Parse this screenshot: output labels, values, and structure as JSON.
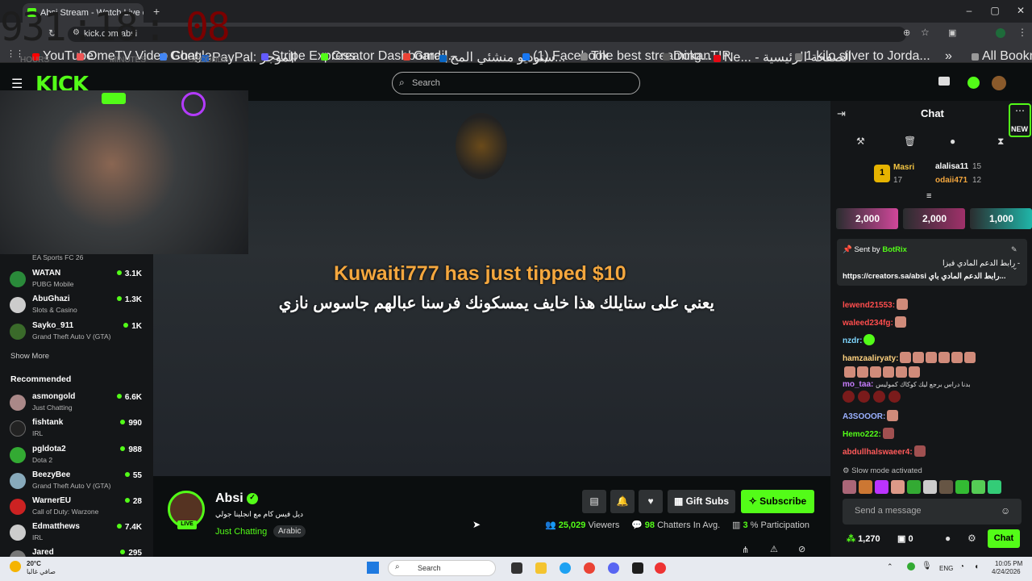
{
  "browser": {
    "tab_title": "Absi Stream - Watch Live o",
    "url": "kick.com/absi",
    "bookmarks": [
      "YouTube",
      "OmeTV Video Chat...",
      "Google",
      "PayPal: الموجز",
      "Stripe Express",
      "Creator Dashboard |...",
      "Gmail",
      "ستوديو منشئي المح...",
      "(1) Facebook",
      "The best streaming...",
      "DokanTIP",
      "Ne... - الصفحة الرئيسية",
      "1 kilo silver to Jorda..."
    ],
    "all_bookmarks": "All Bookmarks"
  },
  "clock": {
    "hours": "931",
    "minutes": "18",
    "seconds": "08",
    "hours_label": "HOURS",
    "minutes_label": "MINUTES",
    "seconds_label": "SECONDS"
  },
  "header": {
    "logo": "KICK",
    "search_placeholder": "Search"
  },
  "sidebar": {
    "partial_top_category": "EA Sports FC 26",
    "following": [
      {
        "name": "WATAN",
        "category": "PUBG Mobile",
        "viewers": "3.1K"
      },
      {
        "name": "AbuGhazi",
        "category": "Slots & Casino",
        "viewers": "1.3K"
      },
      {
        "name": "Sayko_911",
        "category": "Grand Theft Auto V (GTA)",
        "viewers": "1K"
      }
    ],
    "show_more": "Show More",
    "recommended_title": "Recommended",
    "recommended": [
      {
        "name": "asmongold",
        "category": "Just Chatting",
        "viewers": "6.6K"
      },
      {
        "name": "fishtank",
        "category": "IRL",
        "viewers": "990"
      },
      {
        "name": "pgldota2",
        "category": "Dota 2",
        "viewers": "988"
      },
      {
        "name": "BeezyBee",
        "category": "Grand Theft Auto V (GTA)",
        "viewers": "55"
      },
      {
        "name": "WarnerEU",
        "category": "Call of Duty: Warzone",
        "viewers": "28"
      },
      {
        "name": "Edmatthews",
        "category": "IRL",
        "viewers": "7.4K"
      },
      {
        "name": "Jared",
        "category": "",
        "viewers": "295"
      }
    ]
  },
  "video": {
    "tip_message": "Kuwaiti777 has just tipped $10",
    "subtitle": "يعني على ستايلك هذا خايف يمسكونك فرسنا عبالهم جاسوس نازي"
  },
  "stream": {
    "name": "Absi",
    "title": "ديل فيس كام مع انجلينا جولي",
    "category": "Just Chatting",
    "tag": "Arabic",
    "live": "LIVE",
    "gift_subs": "Gift Subs",
    "subscribe": "Subscribe",
    "viewers": "25,029",
    "viewers_label": "Viewers",
    "chatters": "98",
    "chatters_label": "Chatters In Avg.",
    "participation": "3",
    "participation_label": "% Participation"
  },
  "chat": {
    "title": "Chat",
    "new": "NEW",
    "leaderboard": {
      "rank": "1",
      "first": "Masri",
      "first_score": "17",
      "second": "alalisa11",
      "second_score": "15",
      "third": "odaii471",
      "third_score": "12"
    },
    "tips": [
      "2,000",
      "2,000",
      "1,000"
    ],
    "pinned": {
      "sent_by": "Sent by",
      "bot": "BotRix",
      "line1": "- رابط الدعم المادي فيزا",
      "line2": "https://creators.sa/absi رابط الدعم المادي باي..."
    },
    "messages": [
      {
        "user": "lewend21553:",
        "color": "#ff4d4d"
      },
      {
        "user": "waleed234fg:",
        "color": "#ff4d4d"
      },
      {
        "user": "nzdr:",
        "color": "#7fd7ff"
      },
      {
        "user": "hamzaaliryaty:",
        "color": "#ffd27f"
      },
      {
        "user": "mo_taa:",
        "color": "#c77dff",
        "text": "بدنا دراس برجع ليك كوكاك كموليس"
      },
      {
        "user": "A3SOOOR:",
        "color": "#9ab0ff"
      },
      {
        "user": "Hemo222:",
        "color": "#53fc18"
      },
      {
        "user": "abdullhalswaeer4:",
        "color": "#ff5a5a"
      }
    ],
    "slow_mode": "Slow mode activated",
    "send_placeholder": "Send a message",
    "points": "1,270",
    "other_count": "0",
    "chat_button": "Chat"
  },
  "taskbar": {
    "weather_temp": "20°C",
    "weather_desc": "صافي غالبا",
    "search": "Search",
    "lang": "ENG",
    "time": "10:05 PM",
    "date": "4/24/2026"
  }
}
